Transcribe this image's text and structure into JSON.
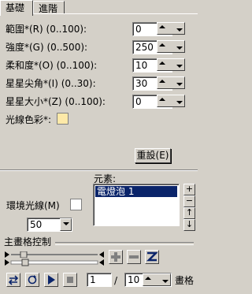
{
  "tabs": [
    {
      "label": "基礎",
      "active": true
    },
    {
      "label": "進階",
      "active": false
    }
  ],
  "fields": [
    {
      "label": "範圍*(R) (0..100):",
      "value": "0"
    },
    {
      "label": "強度*(G) (0..500):",
      "value": "250"
    },
    {
      "label": "柔和度*(O) (0..100):",
      "value": "10"
    },
    {
      "label": "星星尖角*(I) (0..30):",
      "value": "30"
    },
    {
      "label": "星星大小*(Z) (0..100):",
      "value": "0"
    }
  ],
  "light_color": {
    "label": "光線色彩*:",
    "color": "#fde9a8"
  },
  "reset_button": "重設(E)",
  "environment": {
    "label": "環境光線(M)",
    "value": "50",
    "swatch": "#ffffff"
  },
  "elements": {
    "label": "元素:",
    "items": [
      "電燈泡 1"
    ]
  },
  "side_buttons": [
    "+",
    "−",
    "↑",
    "↓"
  ],
  "timeline": {
    "title": "主畫格控制",
    "frame": "1",
    "separator": "/",
    "total": "10",
    "unit": "畫格"
  }
}
